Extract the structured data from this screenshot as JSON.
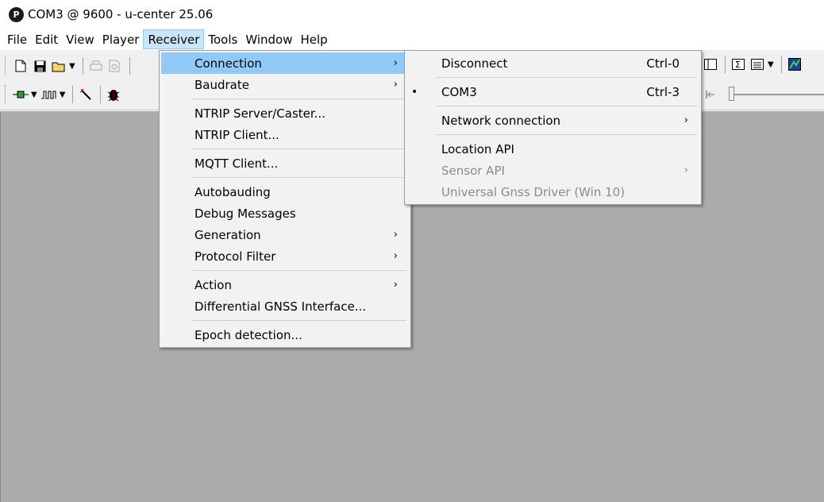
{
  "window": {
    "title": "COM3 @ 9600 - u-center 25.06",
    "icon_letter": "P"
  },
  "menubar": [
    "File",
    "Edit",
    "View",
    "Player",
    "Receiver",
    "Tools",
    "Window",
    "Help"
  ],
  "receiver_menu": {
    "items": [
      {
        "label": "Connection",
        "submenu": true,
        "highlighted": true
      },
      {
        "label": "Baudrate",
        "submenu": true
      },
      {
        "separator": true
      },
      {
        "label": "NTRIP Server/Caster..."
      },
      {
        "label": "NTRIP Client..."
      },
      {
        "separator": true
      },
      {
        "label": "MQTT Client..."
      },
      {
        "separator": true
      },
      {
        "label": "Autobauding"
      },
      {
        "label": "Debug Messages"
      },
      {
        "label": "Generation",
        "submenu": true
      },
      {
        "label": "Protocol Filter",
        "submenu": true
      },
      {
        "separator": true
      },
      {
        "label": "Action",
        "submenu": true
      },
      {
        "label": "Differential GNSS Interface..."
      },
      {
        "separator": true
      },
      {
        "label": "Epoch detection..."
      }
    ]
  },
  "connection_menu": {
    "items": [
      {
        "label": "Disconnect",
        "shortcut": "Ctrl-0"
      },
      {
        "separator": true
      },
      {
        "label": "COM3",
        "shortcut": "Ctrl-3",
        "checked": true
      },
      {
        "separator": true
      },
      {
        "label": "Network connection",
        "submenu": true
      },
      {
        "separator": true
      },
      {
        "label": "Location API"
      },
      {
        "label": "Sensor API",
        "submenu": true,
        "disabled": true
      },
      {
        "label": "Universal Gnss Driver (Win 10)",
        "disabled": true
      }
    ]
  },
  "icons": {
    "new": "new-file-icon",
    "save": "save-icon",
    "open": "open-folder-icon",
    "print": "print-icon",
    "preview": "print-preview-icon",
    "connect": "connection-icon",
    "baud": "baudrate-icon",
    "wizard": "wizard-icon",
    "debug": "debug-bug-icon",
    "panel": "panel-icon",
    "sum": "sum-icon",
    "list": "list-icon",
    "chart": "chart-icon",
    "rewind": "rewind-icon"
  }
}
